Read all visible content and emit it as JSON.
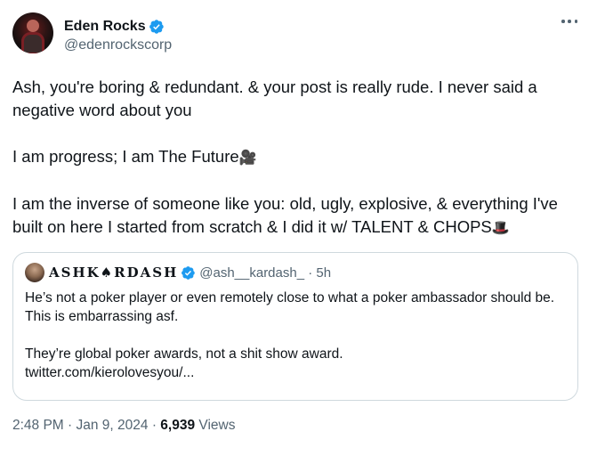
{
  "author": {
    "name": "Eden Rocks",
    "handle": "@edenrockscorp",
    "avatar_icon": "profile-photo",
    "verified_icon": "verified-badge-icon"
  },
  "menu": {
    "icon": "more-dots-icon"
  },
  "tweet": {
    "paragraphs": [
      "Ash, you're boring & redundant. & your post is really rude. I never said a negative word about you",
      "I am progress; I am The Future",
      "I am the inverse of someone like you: old, ugly, explosive, & everything I've built on here I started from scratch & I did it w/ TALENT & CHOPS"
    ],
    "emoji_camera": "🎥",
    "emoji_tophat": "🎩"
  },
  "quote": {
    "name": "ASHK♠RDASH",
    "handle_time": "@ash__kardash_ · 5h",
    "paragraphs": [
      "He’s not a poker player or even remotely close to what a poker ambassador should be. This is embarrassing asf.",
      "They’re global poker awards, not a shit show award."
    ],
    "link": "twitter.com/kierolovesyou/..."
  },
  "meta": {
    "timestamp": "2:48 PM · Jan 9, 2024 · ",
    "views_count": "6,939",
    "views_label": " Views"
  },
  "colors": {
    "verified_blue": "#1d9bf0",
    "secondary_text": "#536471",
    "border": "#cfd9de"
  }
}
